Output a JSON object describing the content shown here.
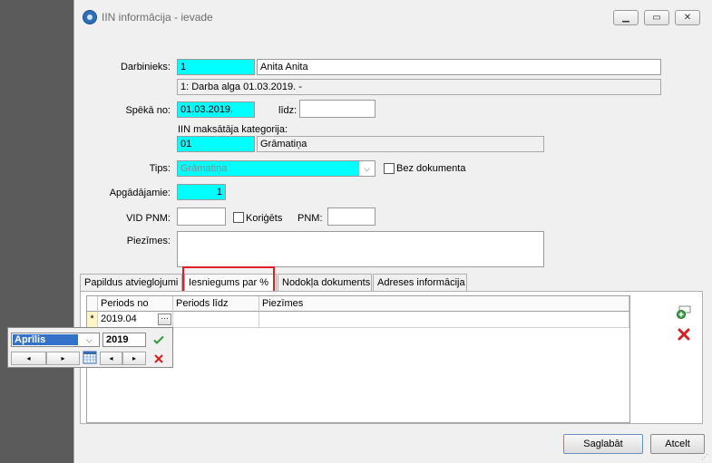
{
  "window": {
    "title": "IIN informācija - ievade"
  },
  "form": {
    "darbinieks": {
      "label": "Darbinieks:",
      "code": "1",
      "name": "Anita Anita",
      "contract": "1: Darba alga  01.03.2019. -"
    },
    "speka": {
      "label": "Spēkā no:",
      "from": "01.03.2019.",
      "to_label": "līdz:",
      "to": ""
    },
    "kategorija": {
      "label": "IIN maksātāja kategorija:",
      "code": "01",
      "name": "Grāmatiņa"
    },
    "tips": {
      "label": "Tips:",
      "value": "Grāmatiņa",
      "bez_dok": "Bez dokumenta"
    },
    "apgadajamie": {
      "label": "Apgādājamie:",
      "value": "1"
    },
    "vid": {
      "label": "VID PNM:",
      "value": "",
      "corrected": "Koriģēts",
      "pnm_label": "PNM:",
      "pnm_value": ""
    },
    "piezimes": {
      "label": "Piezīmes:",
      "value": ""
    }
  },
  "tabs": [
    "Papildus atvieglojumi",
    "Iesniegums par %",
    "Nodokļa dokuments",
    "Adreses informācija"
  ],
  "grid": {
    "columns": [
      "Periods no",
      "Periods līdz",
      "Piezīmes"
    ],
    "rows": [
      {
        "marker": "*",
        "periods_no": "2019.04",
        "ellipsis": "···",
        "periods_lidz": "",
        "piezimes": ""
      }
    ]
  },
  "picker": {
    "month": "Aprīlis",
    "year": "2019"
  },
  "buttons": {
    "save": "Saglabāt",
    "cancel": "Atcelt"
  },
  "colors": {
    "highlight": "#00ffff",
    "tab_outline": "#e02020",
    "selection": "#3471c9"
  }
}
